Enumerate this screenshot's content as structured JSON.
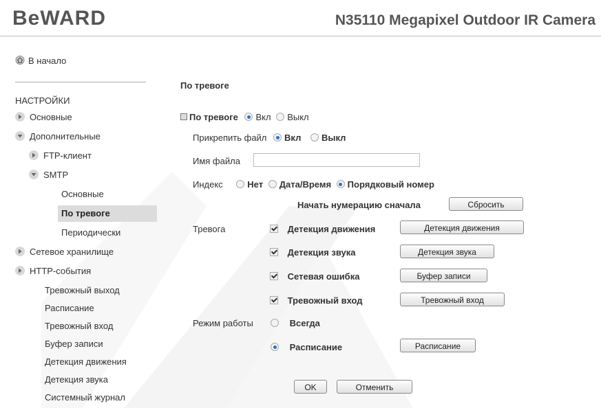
{
  "header": {
    "logo": "BeWARD",
    "product": "N35110 Megapixel Outdoor IR Camera"
  },
  "sidebar": {
    "home": "В начало",
    "section": "НАСТРОЙКИ",
    "items": [
      {
        "label": "Основные",
        "icon": "arrow-right-icon"
      },
      {
        "label": "Дополнительные",
        "icon": "arrow-down-icon"
      },
      {
        "label": "FTP-клиент",
        "icon": "arrow-right-icon"
      },
      {
        "label": "SMTP",
        "icon": "arrow-down-icon"
      },
      {
        "label": "Основные"
      },
      {
        "label": "По тревоге",
        "selected": true
      },
      {
        "label": "Периодически"
      },
      {
        "label": "Сетевое хранилище",
        "icon": "arrow-right-icon"
      },
      {
        "label": "HTTP-события",
        "icon": "arrow-right-icon"
      },
      {
        "label": "Тревожный выход"
      },
      {
        "label": "Расписание"
      },
      {
        "label": "Тревожный вход"
      },
      {
        "label": "Буфер записи"
      },
      {
        "label": "Детекция движения"
      },
      {
        "label": "Детекция звука"
      },
      {
        "label": "Системный журнал"
      }
    ]
  },
  "main": {
    "title": "По тревоге",
    "alarm": {
      "label": "По тревоге",
      "on": "Вкл",
      "off": "Выкл",
      "selected": "on"
    },
    "attach": {
      "label": "Прикрепить файл",
      "on": "Вкл",
      "off": "Выкл",
      "selected": "on"
    },
    "filename": {
      "label": "Имя файла",
      "value": ""
    },
    "index": {
      "label": "Индекс",
      "options": [
        "Нет",
        "Дата/Время",
        "Порядковый номер"
      ],
      "selected": "Порядковый номер"
    },
    "reset": {
      "label": "Начать нумерацию сначала",
      "button": "Сбросить"
    },
    "triggers": {
      "label": "Тревога",
      "items": [
        {
          "label": "Детекция движения",
          "checked": true,
          "button": "Детекция движения"
        },
        {
          "label": "Детекция звука",
          "checked": true,
          "button": "Детекция звука"
        },
        {
          "label": "Сетевая ошибка",
          "checked": true,
          "button": "Буфер записи"
        },
        {
          "label": "Тревожный вход",
          "checked": true,
          "button": "Тревожный вход"
        }
      ]
    },
    "mode": {
      "label": "Режим работы",
      "always": "Всегда",
      "schedule": "Расписание",
      "schedule_button": "Расписание",
      "selected": "schedule"
    },
    "ok": "OK",
    "cancel": "Отменить"
  },
  "colors": {
    "radio_selected": "#2a6fc9",
    "selected_nav_bg": "#dcdcdc",
    "text": "#333333"
  }
}
